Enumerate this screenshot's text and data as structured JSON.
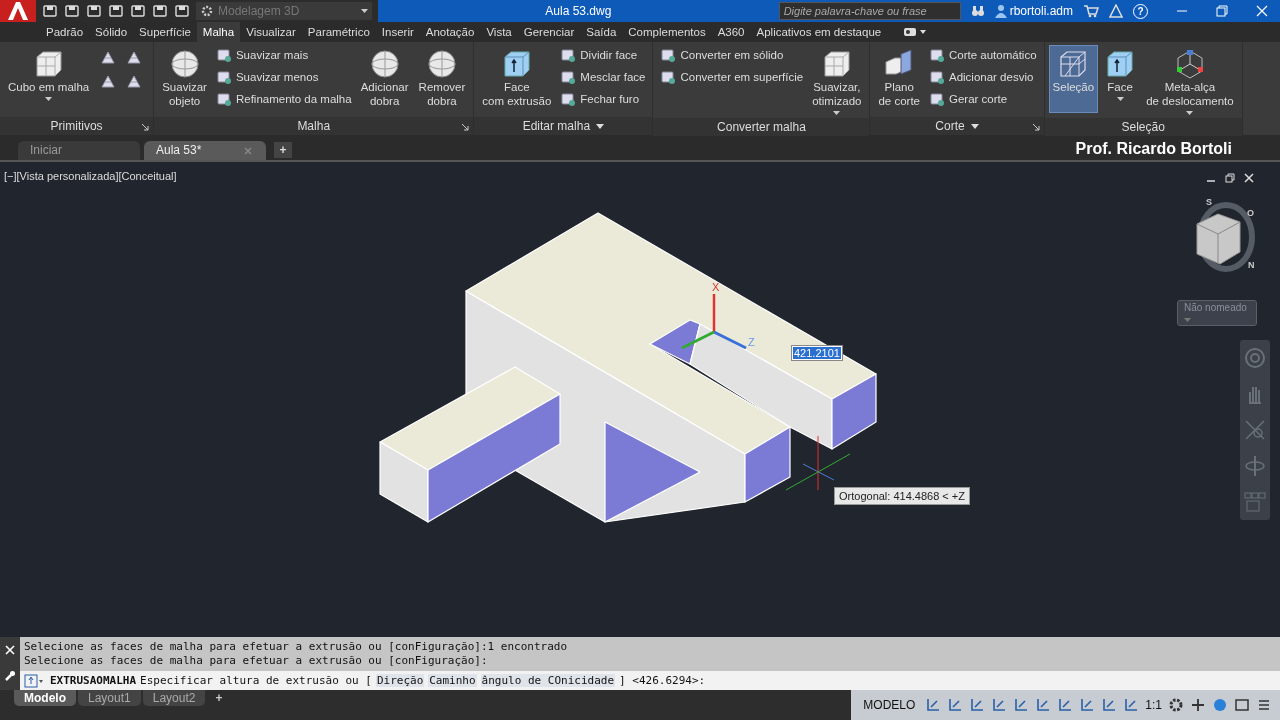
{
  "title_bar": {
    "workspace": "Modelagem 3D",
    "title": "Aula 53.dwg",
    "search": {
      "placeholder": "Digite palavra-chave ou frase"
    },
    "user": "rbortoli.adm",
    "help": "?"
  },
  "ribbon_tabs": [
    {
      "label": "Padrão",
      "selected": false
    },
    {
      "label": "Sólido",
      "selected": false
    },
    {
      "label": "Superfície",
      "selected": false
    },
    {
      "label": "Malha",
      "selected": true
    },
    {
      "label": "Visualizar",
      "selected": false
    },
    {
      "label": "Paramétrico",
      "selected": false
    },
    {
      "label": "Inserir",
      "selected": false
    },
    {
      "label": "Anotação",
      "selected": false
    },
    {
      "label": "Vista",
      "selected": false
    },
    {
      "label": "Gerenciar",
      "selected": false
    },
    {
      "label": "Saída",
      "selected": false
    },
    {
      "label": "Complementos",
      "selected": false
    },
    {
      "label": "A360",
      "selected": false
    },
    {
      "label": "Aplicativos em destaque",
      "selected": false
    }
  ],
  "ribbon_panels": [
    {
      "title": "Primitivos",
      "launcher": true,
      "menu": false,
      "groups": [
        {
          "kind": "large",
          "items": [
            {
              "label": "Cubo em malha",
              "caret": true
            }
          ]
        },
        {
          "kind": "icon_grid"
        }
      ]
    },
    {
      "title": "Malha",
      "launcher": true,
      "menu": false,
      "groups": [
        {
          "kind": "large",
          "items": [
            {
              "label": "Suavizar\nobjeto"
            }
          ]
        },
        {
          "kind": "stack",
          "items": [
            {
              "label": "Suavizar mais"
            },
            {
              "label": "Suavizar menos"
            },
            {
              "label": "Refinamento da malha"
            }
          ]
        },
        {
          "kind": "large",
          "items": [
            {
              "label": "Adicionar\ndobra"
            },
            {
              "label": "Remover\ndobra"
            }
          ]
        }
      ]
    },
    {
      "title": "Editar malha",
      "launcher": false,
      "menu": true,
      "groups": [
        {
          "kind": "large",
          "items": [
            {
              "label": "Face\ncom extrusão"
            }
          ]
        },
        {
          "kind": "stack",
          "items": [
            {
              "label": "Dividir face"
            },
            {
              "label": "Mesclar face"
            },
            {
              "label": "Fechar furo"
            }
          ]
        }
      ]
    },
    {
      "title": "Converter malha",
      "launcher": false,
      "menu": false,
      "groups": [
        {
          "kind": "stack",
          "items": [
            {
              "label": "Converter em sólido"
            },
            {
              "label": "Converter em superfície"
            }
          ]
        },
        {
          "kind": "large",
          "items": [
            {
              "label": "Suavizar,\notimizado",
              "caret": true
            }
          ]
        }
      ]
    },
    {
      "title": "Corte",
      "launcher": true,
      "menu": true,
      "groups": [
        {
          "kind": "large",
          "items": [
            {
              "label": "Plano\nde corte"
            }
          ]
        },
        {
          "kind": "stack",
          "items": [
            {
              "label": "Corte automático"
            },
            {
              "label": "Adicionar desvio"
            },
            {
              "label": "Gerar corte"
            }
          ]
        }
      ]
    },
    {
      "title": "Seleção",
      "launcher": false,
      "menu": false,
      "groups": [
        {
          "kind": "large",
          "items": [
            {
              "label": "Seleção",
              "selected": true
            },
            {
              "label": "Face",
              "caret": true,
              "selected": false
            },
            {
              "label": "Meta-alça\nde deslocamento",
              "caret": true,
              "selected": false
            }
          ]
        }
      ]
    }
  ],
  "doc_tabs": [
    {
      "label": "Iniciar",
      "selected": false
    },
    {
      "label": "Aula 53*",
      "selected": true
    }
  ],
  "new_tab": "+",
  "author": "Prof. Ricardo Bortoli",
  "viewport": {
    "label": "[−][Vista personalizada][Conceitual]",
    "compass": [
      "S",
      "O",
      "N"
    ],
    "view_name": "Não nomeado",
    "ucs": {
      "x_label": "X",
      "z_label": "Z"
    },
    "dynamic_input": "421.2101",
    "tooltip": "Ortogonal: 414.4868 < +Z"
  },
  "command": {
    "history": [
      "Selecione as faces de malha para efetuar a extrusão ou [conFiguração]:1 encontrado",
      "Selecione as faces de malha para efetuar a extrusão ou [conFiguração]:"
    ],
    "input": {
      "command": "EXTRUSAOMALHA",
      "prompt": "Especificar altura de extrusão ou [",
      "options": [
        "Direção",
        "Caminho",
        "ângulo de COnicidade"
      ],
      "suffix": "] <426.6294>:"
    }
  },
  "status_bar": {
    "layout_tabs": [
      {
        "label": "Modelo",
        "selected": true
      },
      {
        "label": "Layout1",
        "selected": false
      },
      {
        "label": "Layout2",
        "selected": false
      }
    ],
    "add": "+",
    "mode": "MODELO",
    "scale": "1:1"
  }
}
